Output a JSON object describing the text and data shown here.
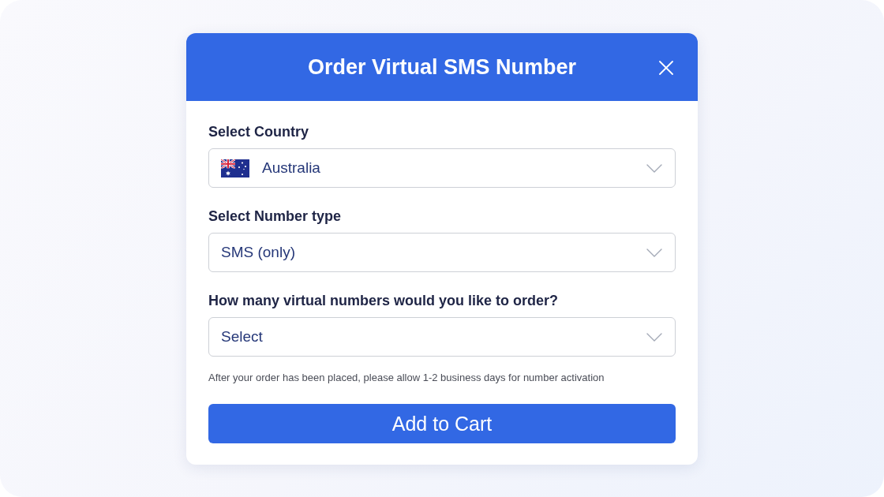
{
  "dialog": {
    "title": "Order Virtual SMS Number",
    "fields": [
      {
        "kind": "country",
        "label": "Select Country",
        "value": "Australia"
      },
      {
        "kind": "select",
        "label": "Select Number type",
        "value": "SMS (only)"
      },
      {
        "kind": "select",
        "label": "How many virtual numbers would you like to order?",
        "placeholder": "Select"
      }
    ],
    "note": "After your order has been placed, please allow 1-2 business days for number activation",
    "button": "Add to Cart"
  }
}
